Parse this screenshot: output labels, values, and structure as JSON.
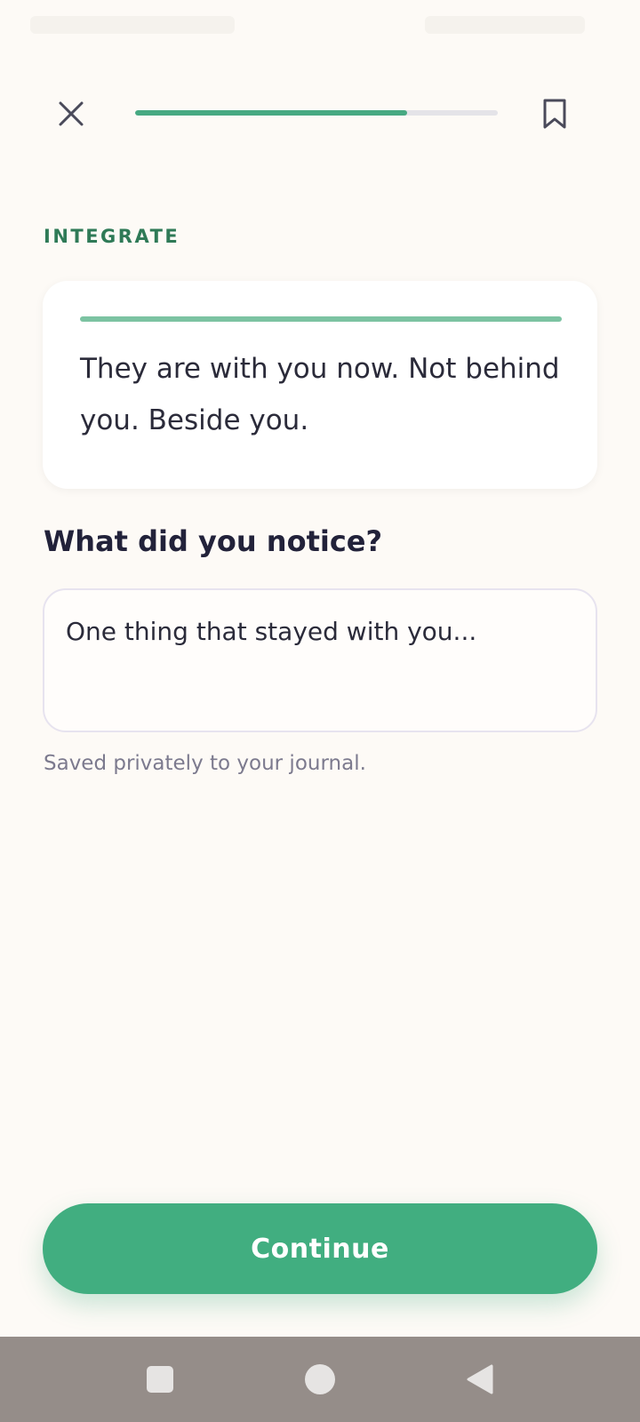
{
  "colors": {
    "background": "#fdfaf6",
    "accent_green": "#41ae80",
    "label_green": "#2f7a57",
    "progress_fill": "#47a982",
    "progress_track": "#e4e3e8",
    "quote_accent": "#7cc3a2",
    "text_dark": "#22223a",
    "text_muted": "#7c7a8e",
    "nav_bar": "#958d89"
  },
  "top_bar": {
    "close_icon": "close-icon",
    "bookmark_icon": "bookmark-icon",
    "progress": 0.75
  },
  "section": {
    "label": "INTEGRATE"
  },
  "quote": {
    "text": "They are with you now. Not behind you. Beside you."
  },
  "prompt": {
    "question": "What did you notice?",
    "placeholder": "One thing that stayed with you...",
    "value": "",
    "helper": "Saved privately to your journal."
  },
  "actions": {
    "continue_label": "Continue"
  },
  "system_nav": {
    "recents_icon": "square-icon",
    "home_icon": "circle-icon",
    "back_icon": "triangle-back-icon"
  }
}
